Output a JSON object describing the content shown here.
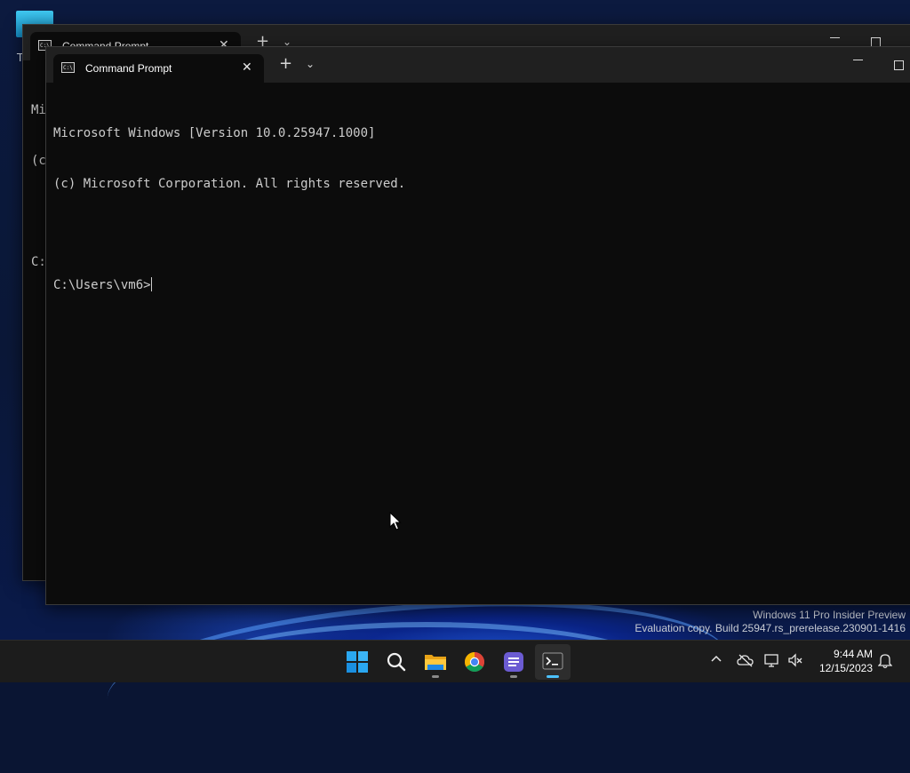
{
  "desktop": {
    "icon_label": "T",
    "watermark": {
      "line1": "Windows 11 Pro Insider Preview",
      "line2": "Evaluation copy. Build 25947.rs_prerelease.230901-1416"
    }
  },
  "back_window": {
    "tab_title": "Command Prompt",
    "tab_icon_text": "C:\\",
    "console_fragments": [
      "Mi",
      "(c",
      "",
      "C:"
    ]
  },
  "front_window": {
    "tab_title": "Command Prompt",
    "tab_icon_text": "C:\\",
    "console_lines": [
      "Microsoft Windows [Version 10.0.25947.1000]",
      "(c) Microsoft Corporation. All rights reserved.",
      ""
    ],
    "prompt": "C:\\Users\\vm6>"
  },
  "taskbar": {
    "apps": [
      {
        "name": "start",
        "icon": "windows-logo-icon"
      },
      {
        "name": "search",
        "icon": "search-icon"
      },
      {
        "name": "file-explorer",
        "icon": "folder-icon"
      },
      {
        "name": "chrome",
        "icon": "chrome-icon"
      },
      {
        "name": "notes-app",
        "icon": "notes-icon"
      },
      {
        "name": "terminal",
        "icon": "terminal-icon"
      }
    ],
    "clock": {
      "time": "9:44 AM",
      "date": "12/15/2023"
    }
  },
  "colors": {
    "terminal_bg": "#0c0c0c",
    "titlebar_bg": "#202020",
    "taskbar_bg": "#1c1c1c",
    "accent": "#4cc2ff"
  }
}
